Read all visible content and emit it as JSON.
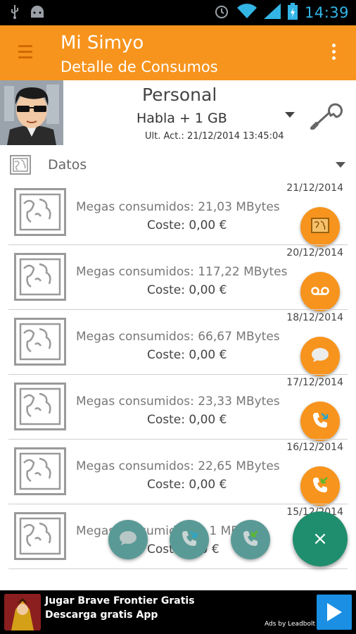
{
  "status_bar": {
    "time": "14:39",
    "left_icons": [
      "usb-icon",
      "android-icon"
    ],
    "right_icons": [
      "alarm-icon",
      "wifi-icon",
      "signal-icon",
      "battery-icon"
    ]
  },
  "app_bar": {
    "title": "Mi Simyo",
    "subtitle": "Detalle de Consumos",
    "background": "#f7941d"
  },
  "profile": {
    "plan_name": "Personal",
    "plan_detail": "Habla + 1 GB",
    "updated": "Ult. Act.: 21/12/2014 13:45:04"
  },
  "section": {
    "label": "Datos"
  },
  "list": {
    "rows": [
      {
        "date": "21/12/2014",
        "megas": "Megas consumidos: 21,03 MBytes",
        "cost": "Coste: 0,00 €",
        "fab_icon": "map-icon"
      },
      {
        "date": "20/12/2014",
        "megas": "Megas consumidos: 117,22 MBytes",
        "cost": "Coste: 0,00 €",
        "fab_icon": "voicemail-icon"
      },
      {
        "date": "18/12/2014",
        "megas": "Megas consumidos: 66,67 MBytes",
        "cost": "Coste: 0,00 €",
        "fab_icon": "sms-icon"
      },
      {
        "date": "17/12/2014",
        "megas": "Megas consumidos: 23,33 MBytes",
        "cost": "Coste: 0,00 €",
        "fab_icon": "call-outgoing-icon"
      },
      {
        "date": "16/12/2014",
        "megas": "Megas consumidos: 22,65 MBytes",
        "cost": "Coste: 0,00 €",
        "fab_icon": "call-incoming-icon"
      },
      {
        "date": "15/12/2014",
        "megas": "Megas consumidos: ...1 MBytes",
        "cost": "Coste: ...0 €",
        "fab_icon": ""
      }
    ]
  },
  "speed_dial": {
    "main_label": "×",
    "actions": [
      "sms-icon",
      "call-outgoing-icon",
      "call-incoming-icon"
    ]
  },
  "ad": {
    "title": "Jugar Brave Frontier Gratis",
    "subtitle": "Descarga gratis App",
    "by": "Ads by Leadbolt"
  }
}
